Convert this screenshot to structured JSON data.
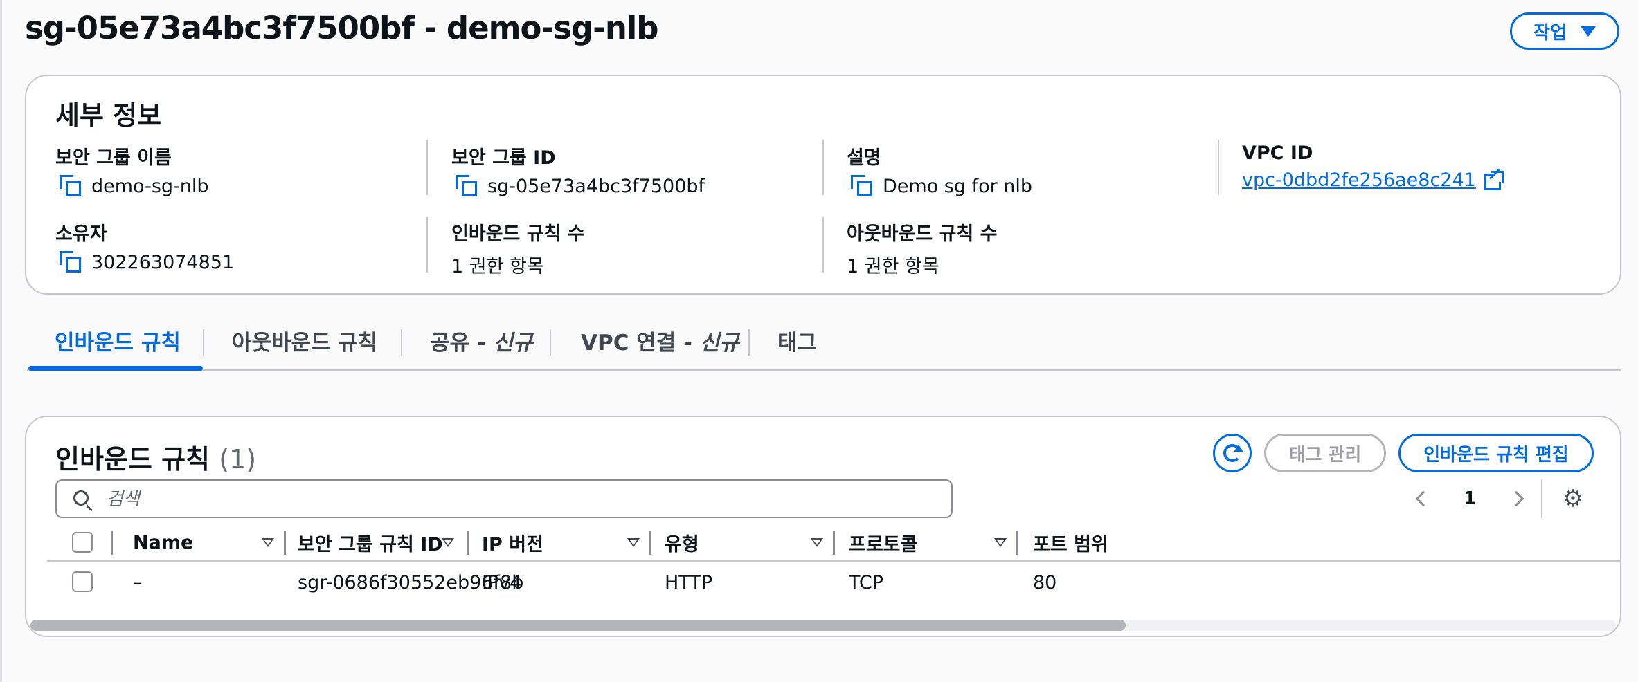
{
  "header": {
    "title": "sg-05e73a4bc3f7500bf - demo-sg-nlb",
    "actions_label": "작업"
  },
  "details": {
    "title": "세부 정보",
    "fields": {
      "sg_name": {
        "label": "보안 그룹 이름",
        "value": "demo-sg-nlb"
      },
      "sg_id": {
        "label": "보안 그룹 ID",
        "value": "sg-05e73a4bc3f7500bf"
      },
      "description": {
        "label": "설명",
        "value": "Demo sg for nlb"
      },
      "vpc_id": {
        "label": "VPC ID",
        "value": "vpc-0dbd2fe256ae8c241"
      },
      "owner": {
        "label": "소유자",
        "value": "302263074851"
      },
      "inbound_count": {
        "label": "인바운드 규칙 수",
        "value": "1 권한 항목"
      },
      "outbound_count": {
        "label": "아웃바운드 규칙 수",
        "value": "1 권한 항목"
      }
    }
  },
  "tabs": [
    {
      "label": "인바운드 규칙",
      "suffix": ""
    },
    {
      "label": "아웃바운드 규칙",
      "suffix": ""
    },
    {
      "label": "공유 - ",
      "suffix": "신규"
    },
    {
      "label": "VPC 연결 - ",
      "suffix": "신규"
    },
    {
      "label": "태그",
      "suffix": ""
    }
  ],
  "active_tab": 0,
  "rules_panel": {
    "title": "인바운드 규칙",
    "count": "(1)",
    "manage_tags_label": "태그 관리",
    "edit_rules_label": "인바운드 규칙 편집",
    "search_placeholder": "검색",
    "page": "1",
    "columns": [
      "Name",
      "보안 그룹 규칙 ID",
      "IP 버전",
      "유형",
      "프로토콜",
      "포트 범위"
    ],
    "rows": [
      [
        "–",
        "sgr-0686f30552eb96f8b",
        "IPv4",
        "HTTP",
        "TCP",
        "80"
      ]
    ]
  },
  "colors": {
    "accent": "#006ce0",
    "border": "#c6c6cd",
    "text": "#0f141a",
    "disabled": "#9c9ca3"
  },
  "icons": [
    "caret-down-icon",
    "copy-icon",
    "external-link-icon",
    "refresh-icon",
    "search-icon",
    "chevron-left-icon",
    "chevron-right-icon",
    "gear-icon",
    "sort-caret-icon"
  ]
}
